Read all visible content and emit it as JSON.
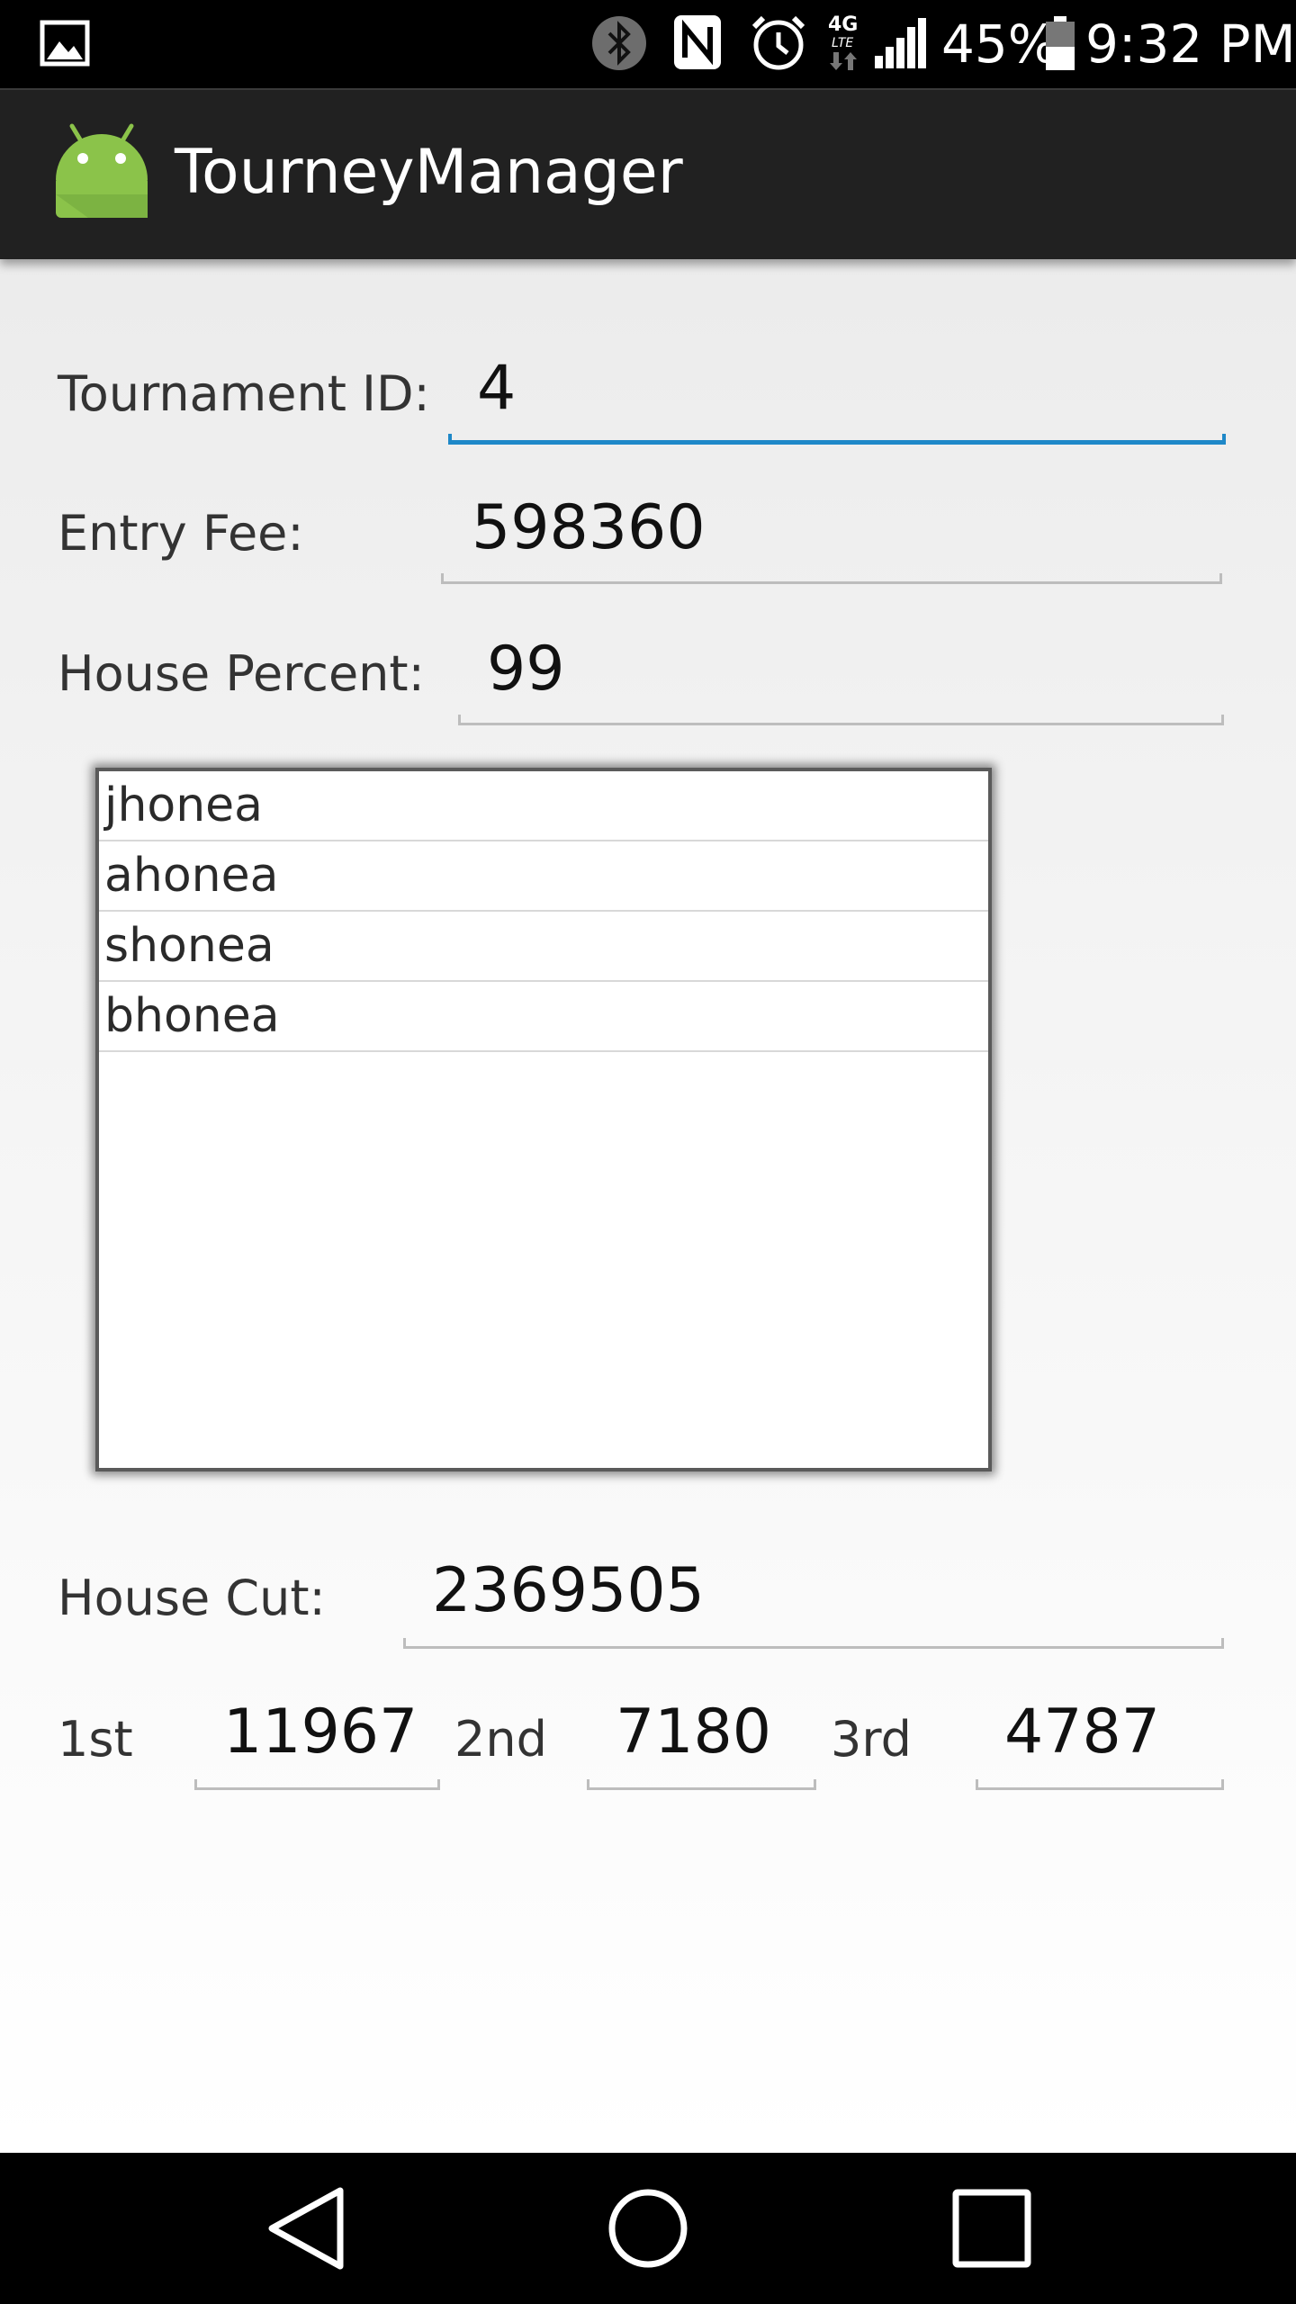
{
  "status_bar": {
    "battery_percent": "45%",
    "time": "9:32 PM",
    "icons": [
      "gallery-icon",
      "bluetooth-icon",
      "nfc-icon",
      "alarm-icon",
      "4g-lte-icon",
      "signal-icon",
      "battery-icon"
    ]
  },
  "action_bar": {
    "title": "TourneyManager",
    "icon": "android-icon"
  },
  "form": {
    "tournament_id": {
      "label": "Tournament ID:",
      "value": "4"
    },
    "entry_fee": {
      "label": "Entry Fee:",
      "value": "598360"
    },
    "house_percent": {
      "label": "House Percent:",
      "value": "99"
    }
  },
  "players": [
    "jhonea",
    "ahonea",
    "shonea",
    "bhonea"
  ],
  "house_cut": {
    "label": "House Cut:",
    "value": "2369505"
  },
  "prizes": [
    {
      "label": "1st",
      "value": "11967"
    },
    {
      "label": "2nd",
      "value": "7180"
    },
    {
      "label": "3rd",
      "value": "4787"
    }
  ],
  "nav_bar": {
    "icons": [
      "back-icon",
      "home-icon",
      "recents-icon"
    ]
  },
  "colors": {
    "accent": "#1e88c8",
    "android_green": "#8bc34a",
    "action_bar": "#212121"
  }
}
